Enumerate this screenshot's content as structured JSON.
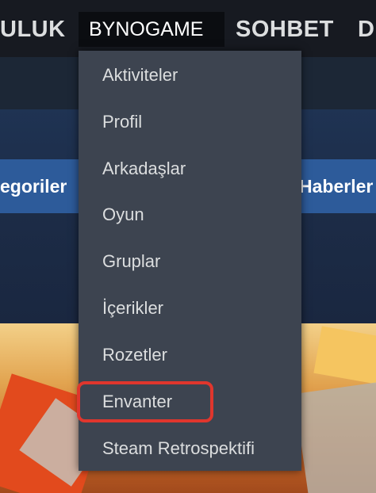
{
  "nav": {
    "items": [
      "ULUK",
      "SOHBET",
      "D"
    ],
    "active": "BYNOGAME"
  },
  "categories": {
    "left_label": "egoriler",
    "right_label": "Haberler"
  },
  "dropdown": {
    "items": [
      "Aktiviteler",
      "Profil",
      "Arkadaşlar",
      "Oyun",
      "Gruplar",
      "İçerikler",
      "Rozetler",
      "Envanter",
      "Steam Retrospektifi"
    ],
    "highlighted": "Envanter"
  },
  "colors": {
    "menu_bg": "#3d4450",
    "highlight": "#e0362d",
    "accent": "#2d5b9a"
  }
}
